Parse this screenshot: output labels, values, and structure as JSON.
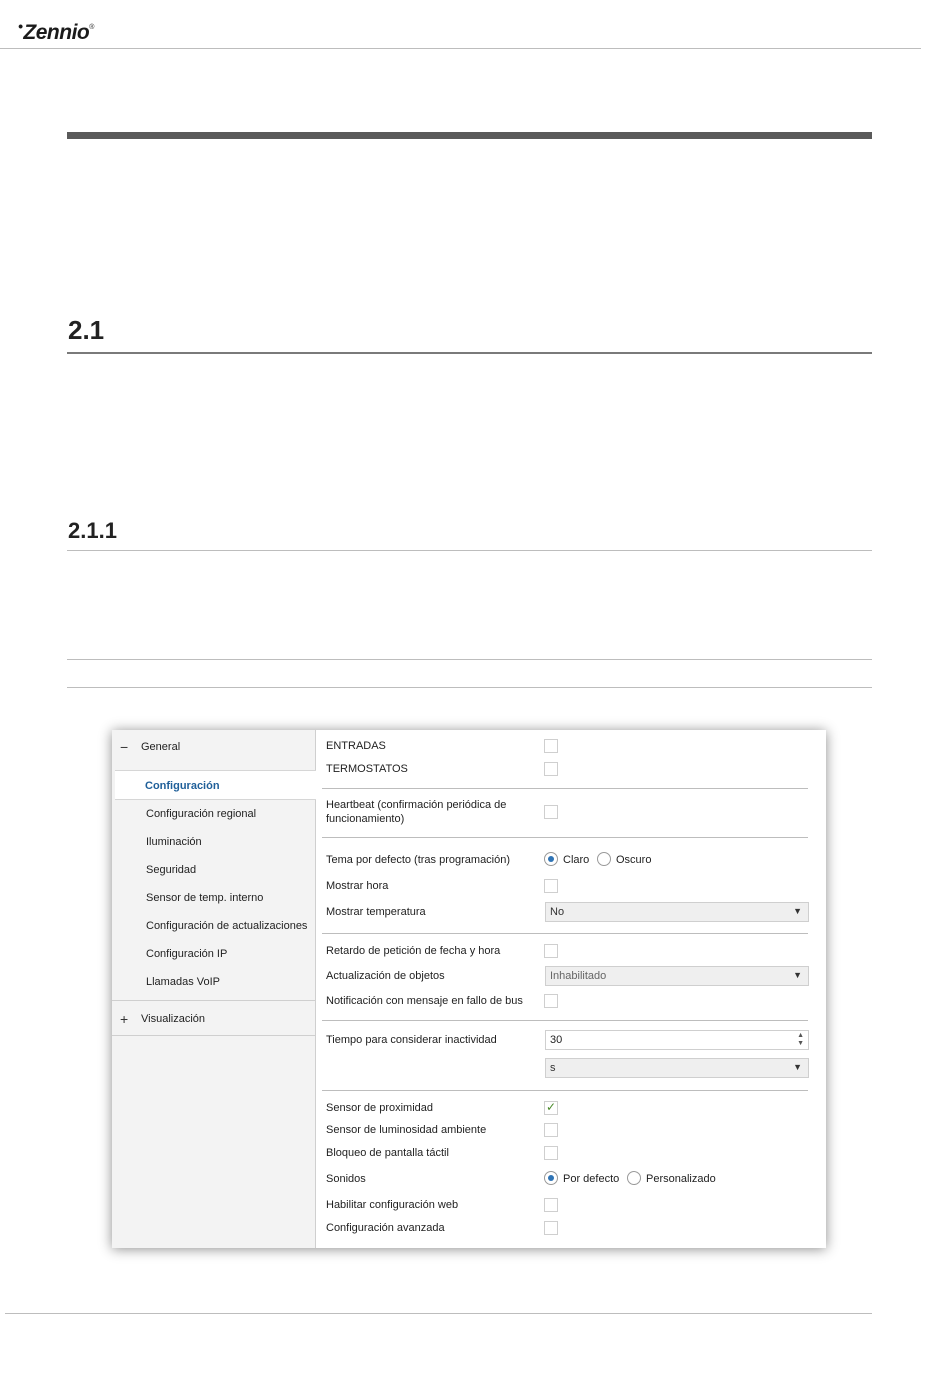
{
  "header": {
    "logo_text": "Zennio",
    "logo_reg": "®"
  },
  "doc": {
    "section": "2.1",
    "subsection": "2.1.1"
  },
  "sidebar": {
    "groups": [
      {
        "sign": "−",
        "label": "General"
      },
      {
        "sign": "+",
        "label": "Visualización"
      }
    ],
    "active_item": "Configuración",
    "items": [
      "Configuración regional",
      "Iluminación",
      "Seguridad",
      "Sensor de temp. interno",
      "Configuración de actualizaciones",
      "Configuración IP",
      "Llamadas VoIP"
    ]
  },
  "params": {
    "entradas": "ENTRADAS",
    "termostatos": "TERMOSTATOS",
    "heartbeat_1": "Heartbeat (confirmación periódica de",
    "heartbeat_2": "funcionamiento)",
    "tema": "Tema por defecto (tras programación)",
    "tema_opt1": "Claro",
    "tema_opt2": "Oscuro",
    "mostrar_hora": "Mostrar hora",
    "mostrar_temp": "Mostrar temperatura",
    "mostrar_temp_val": "No",
    "retardo": "Retardo de petición de fecha y hora",
    "actualizacion": "Actualización de objetos",
    "actualizacion_val": "Inhabilitado",
    "notificacion": "Notificación con mensaje en fallo de bus",
    "tiempo": "Tiempo para considerar inactividad",
    "tiempo_val": "30",
    "tiempo_unit": "s",
    "sensor_prox": "Sensor de proximidad",
    "sensor_lum": "Sensor de luminosidad ambiente",
    "bloqueo": "Bloqueo de pantalla táctil",
    "sonidos": "Sonidos",
    "sonidos_opt1": "Por defecto",
    "sonidos_opt2": "Personalizado",
    "web": "Habilitar configuración web",
    "avanzada": "Configuración avanzada"
  },
  "colors": {
    "accent": "#1f5f99",
    "check": "#4a8a2a",
    "radio": "#2f74b5"
  }
}
